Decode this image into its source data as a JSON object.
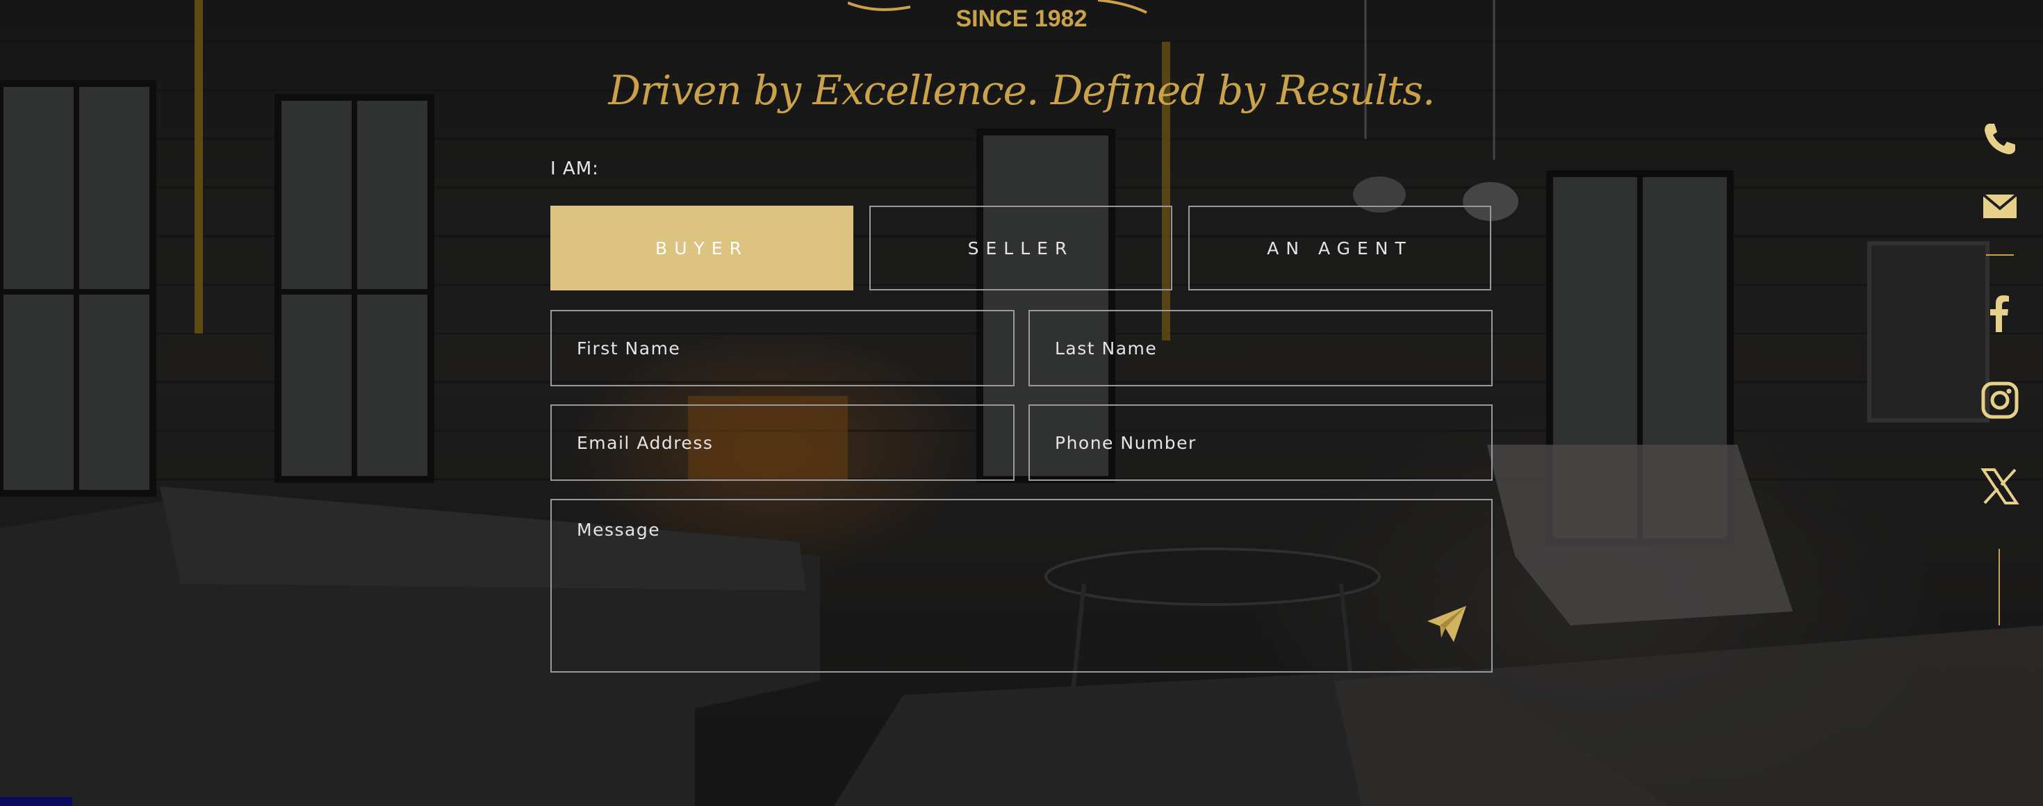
{
  "brand": {
    "tagline": "SINCE 1982"
  },
  "headline": "Driven by Excellence.  Defined by Results.",
  "form": {
    "role_label": "I AM:",
    "roles": [
      {
        "label": "BUYER",
        "selected": true
      },
      {
        "label": "SELLER",
        "selected": false
      },
      {
        "label": "AN AGENT",
        "selected": false
      }
    ],
    "fields": {
      "first_name": "First Name",
      "last_name": "Last Name",
      "email": "Email Address",
      "phone": "Phone Number",
      "message": "Message"
    },
    "send_icon": "paper-plane-icon"
  },
  "social": {
    "icons": [
      "phone-icon",
      "envelope-icon",
      "facebook-icon",
      "instagram-icon",
      "x-icon"
    ]
  },
  "colors": {
    "gold": "#c9a24a",
    "button_fill": "#dcc37f",
    "border": "#9a9a9a",
    "text": "#e8e8e8"
  }
}
